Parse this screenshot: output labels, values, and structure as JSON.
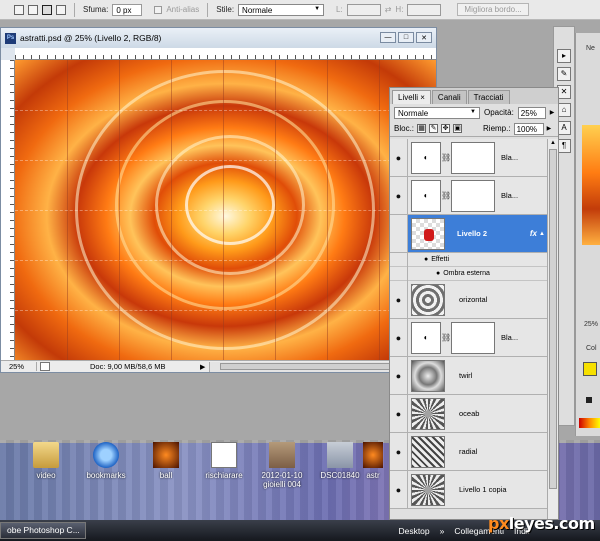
{
  "options_bar": {
    "feather_label": "Sfuma:",
    "feather_value": "0 px",
    "antialias_label": "Anti-alias",
    "style_label": "Stile:",
    "style_value": "Normale",
    "width_label": "L:",
    "height_label": "H:",
    "refine_edge_label": "Migliora bordo..."
  },
  "document": {
    "title": "astratti.psd @ 25% (Livello 2, RGB/8)",
    "zoom": "25%",
    "doc_info": "Doc: 9,00 MB/58,6 MB",
    "window_buttons": [
      "—",
      "□",
      "✕"
    ]
  },
  "layers_panel": {
    "tabs": [
      "Livelli",
      "Canali",
      "Tracciati"
    ],
    "tab_close": "×",
    "blend_mode": "Normale",
    "opacity_label": "Opacità:",
    "opacity_value": "25%",
    "lock_label": "Bloc.:",
    "fill_label": "Riemp.:",
    "fill_value": "100%",
    "layers": [
      {
        "name": "Bla...",
        "type": "adjustment"
      },
      {
        "name": "Bla...",
        "type": "adjustment"
      },
      {
        "name": "Livello 2",
        "type": "pixel",
        "selected": true,
        "fx": "fx"
      },
      {
        "name": "orizontal",
        "type": "texture"
      },
      {
        "name": "Bla...",
        "type": "adjustment"
      },
      {
        "name": "twirl",
        "type": "texture"
      },
      {
        "name": "oceab",
        "type": "texture"
      },
      {
        "name": "radial",
        "type": "texture"
      },
      {
        "name": "Livello 1 copia",
        "type": "texture"
      }
    ],
    "effects": {
      "label": "Effetti",
      "item": "Ombra esterna"
    }
  },
  "right_panel": {
    "label_top": "Ne",
    "label_mid": "25%",
    "label_col": "Col"
  },
  "desktop_icons": [
    {
      "label": "video",
      "icon": "folder-icon"
    },
    {
      "label": "bookmarks",
      "icon": "internet-explorer-icon"
    },
    {
      "label": "ball",
      "icon": "image-icon"
    },
    {
      "label": "rischiarare",
      "icon": "document-icon"
    },
    {
      "label": "2012-01-10 gioielli 004",
      "icon": "photo-icon"
    },
    {
      "label": "DSC01840",
      "icon": "photo-icon"
    },
    {
      "label": "astr",
      "icon": "image-icon"
    }
  ],
  "taskbar": {
    "app_button": "obe Photoshop C...",
    "desktop": "Desktop",
    "links": "Collegamenti",
    "indirizzo": "Indir"
  },
  "watermark": {
    "prefix": "px",
    "suffix": "leyes.com"
  },
  "colors": {
    "selected_layer": "#3d7ed8",
    "accent_orange": "#ff8b1f"
  }
}
